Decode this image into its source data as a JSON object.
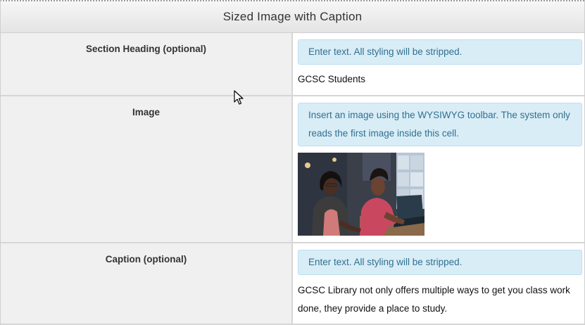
{
  "header": {
    "title": "Sized Image with Caption"
  },
  "rows": [
    {
      "label": "Section Heading (optional)",
      "hint": "Enter text. All styling will be stripped.",
      "value": "GCSC Students"
    },
    {
      "label": "Image",
      "hint": "Insert an image using the WYSIWYG toolbar. The system only reads the first image inside this cell.",
      "image_description": "photo-two-students-at-laptop"
    },
    {
      "label": "Caption (optional)",
      "hint": "Enter text. All styling will be stripped.",
      "value": "GCSC Library not only offers multiple ways to get you class work done, they provide a place to study."
    }
  ],
  "colors": {
    "hint_bg": "#d9edf7",
    "hint_text": "#31708f",
    "label_bg": "#f0f0f0"
  }
}
